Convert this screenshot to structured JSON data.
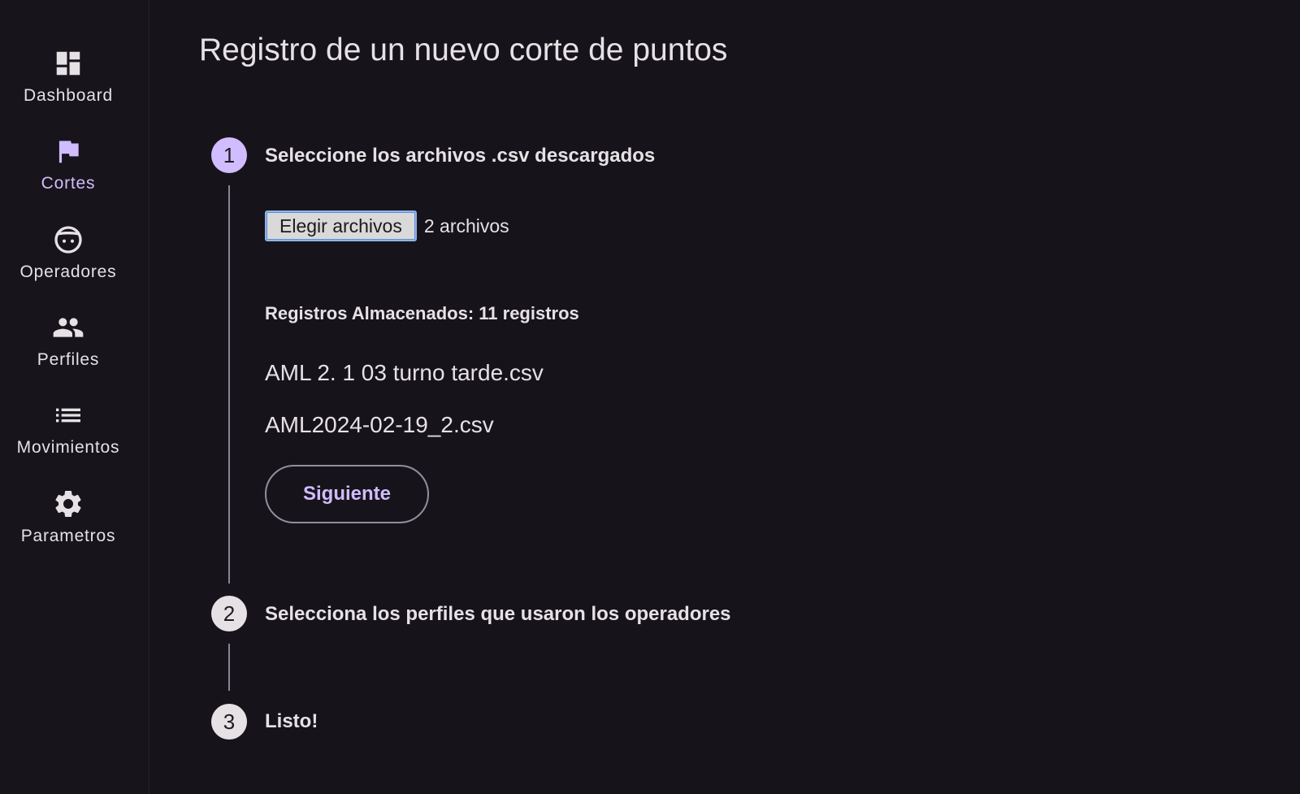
{
  "sidebar": {
    "accent_color": "#d0bcff",
    "items": [
      {
        "label": "Dashboard",
        "icon": "dashboard-icon",
        "active": false
      },
      {
        "label": "Cortes",
        "icon": "flag-icon",
        "active": true
      },
      {
        "label": "Operadores",
        "icon": "face-icon",
        "active": false
      },
      {
        "label": "Perfiles",
        "icon": "people-icon",
        "active": false
      },
      {
        "label": "Movimientos",
        "icon": "list-icon",
        "active": false
      },
      {
        "label": "Parametros",
        "icon": "gear-icon",
        "active": false
      }
    ]
  },
  "main": {
    "title": "Registro de un nuevo corte de puntos",
    "steps": [
      {
        "number": "1",
        "title": "Seleccione los archivos .csv descargados",
        "active": true
      },
      {
        "number": "2",
        "title": "Selecciona los perfiles que usaron los operadores",
        "active": false
      },
      {
        "number": "3",
        "title": "Listo!",
        "active": false
      }
    ],
    "file_input": {
      "button_label": "Elegir archivos",
      "selected_text": "2 archivos"
    },
    "records_label": "Registros Almacenados: 11 registros",
    "files": [
      "AML 2. 1 03 turno tarde.csv",
      "AML2024-02-19_2.csv"
    ],
    "next_label": "Siguiente"
  }
}
